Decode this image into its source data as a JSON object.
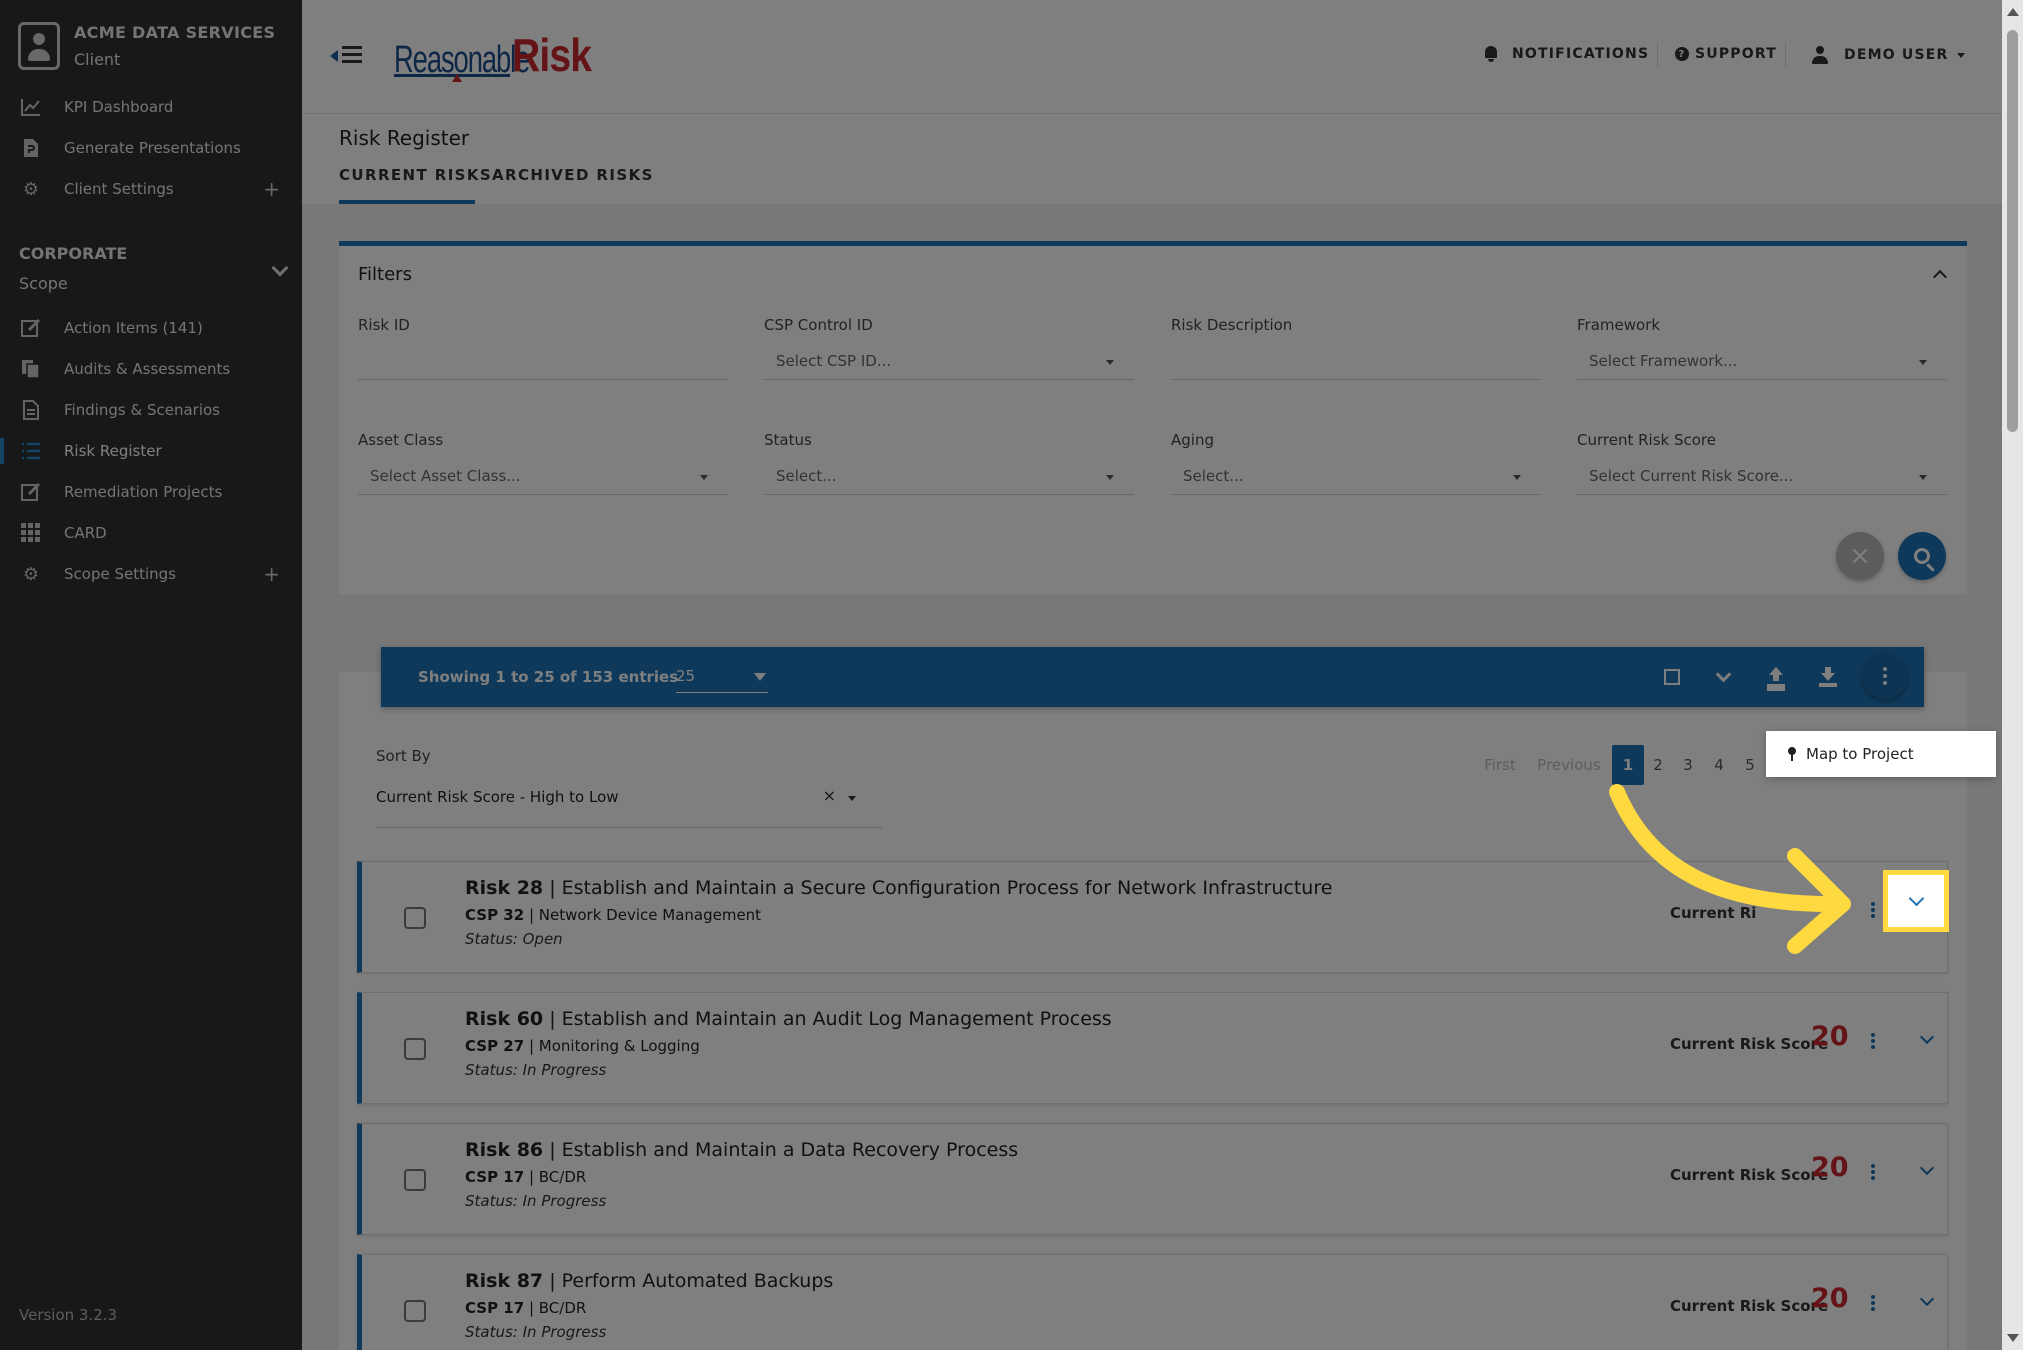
{
  "sidebar": {
    "client_name": "ACME DATA SERVICES",
    "client_sub": "Client",
    "top_items": [
      {
        "label": "KPI Dashboard",
        "icon": "chart-line-icon"
      },
      {
        "label": "Generate Presentations",
        "icon": "file-powerpoint-icon"
      },
      {
        "label": "Client Settings",
        "icon": "gear-icon"
      }
    ],
    "scope_title": "CORPORATE",
    "scope_sub": "Scope",
    "scope_items": [
      {
        "label": "Action Items (141)",
        "icon": "edit-icon"
      },
      {
        "label": "Audits & Assessments",
        "icon": "files-icon"
      },
      {
        "label": "Findings & Scenarios",
        "icon": "document-icon"
      },
      {
        "label": "Risk Register",
        "icon": "list-icon"
      },
      {
        "label": "Remediation Projects",
        "icon": "edit-icon"
      },
      {
        "label": "CARD",
        "icon": "grid-icon"
      },
      {
        "label": "Scope Settings",
        "icon": "gear-icon"
      }
    ],
    "version": "Version 3.2.3"
  },
  "header": {
    "logo_part1": "Reasonable",
    "logo_part2": "Risk",
    "notifications": "NOTIFICATIONS",
    "support": "SUPPORT",
    "user": "DEMO USER"
  },
  "page": {
    "title": "Risk Register",
    "tabs": [
      "CURRENT RISKS",
      "ARCHIVED RISKS"
    ]
  },
  "filters": {
    "title": "Filters",
    "fields": [
      {
        "label": "Risk ID",
        "placeholder": ""
      },
      {
        "label": "CSP Control ID",
        "placeholder": "Select CSP ID..."
      },
      {
        "label": "Risk Description",
        "placeholder": ""
      },
      {
        "label": "Framework",
        "placeholder": "Select Framework..."
      },
      {
        "label": "Asset Class",
        "placeholder": "Select Asset Class..."
      },
      {
        "label": "Status",
        "placeholder": "Select..."
      },
      {
        "label": "Aging",
        "placeholder": "Select..."
      },
      {
        "label": "Current Risk Score",
        "placeholder": "Select Current Risk Score..."
      }
    ]
  },
  "toolbar": {
    "entries_text": "Showing 1 to 25 of 153 entries",
    "page_size": "25"
  },
  "sort": {
    "label": "Sort By",
    "value": "Current Risk Score - High to Low",
    "clear": "×"
  },
  "pagination": {
    "first": "First",
    "previous": "Previous",
    "pages": [
      "1",
      "2",
      "3",
      "4",
      "5"
    ],
    "current": "1"
  },
  "menu": {
    "map_to_project": "Map to Project"
  },
  "risks": [
    {
      "id": "Risk 28",
      "title": "Establish and Maintain a Secure Configuration Process for Network Infrastructure",
      "csp": "CSP 32",
      "csp_name": "Network Device Management",
      "status": "Status: Open",
      "score_label": "Current Ri",
      "score": ""
    },
    {
      "id": "Risk 60",
      "title": "Establish and Maintain an Audit Log Management Process",
      "csp": "CSP 27",
      "csp_name": "Monitoring & Logging",
      "status": "Status: In Progress",
      "score_label": "Current Risk Score",
      "score": "20"
    },
    {
      "id": "Risk 86",
      "title": "Establish and Maintain a Data Recovery Process",
      "csp": "CSP 17",
      "csp_name": "BC/DR",
      "status": "Status: In Progress",
      "score_label": "Current Risk Score",
      "score": "20"
    },
    {
      "id": "Risk 87",
      "title": "Perform Automated Backups",
      "csp": "CSP 17",
      "csp_name": "BC/DR",
      "status": "Status: In Progress",
      "score_label": "Current Risk Score",
      "score": "20"
    }
  ],
  "colors": {
    "sidebar_bg": "#2e3033",
    "accent_blue": "#1e73b5",
    "score_red": "#c9282d",
    "highlight_yellow": "#ffd940"
  }
}
